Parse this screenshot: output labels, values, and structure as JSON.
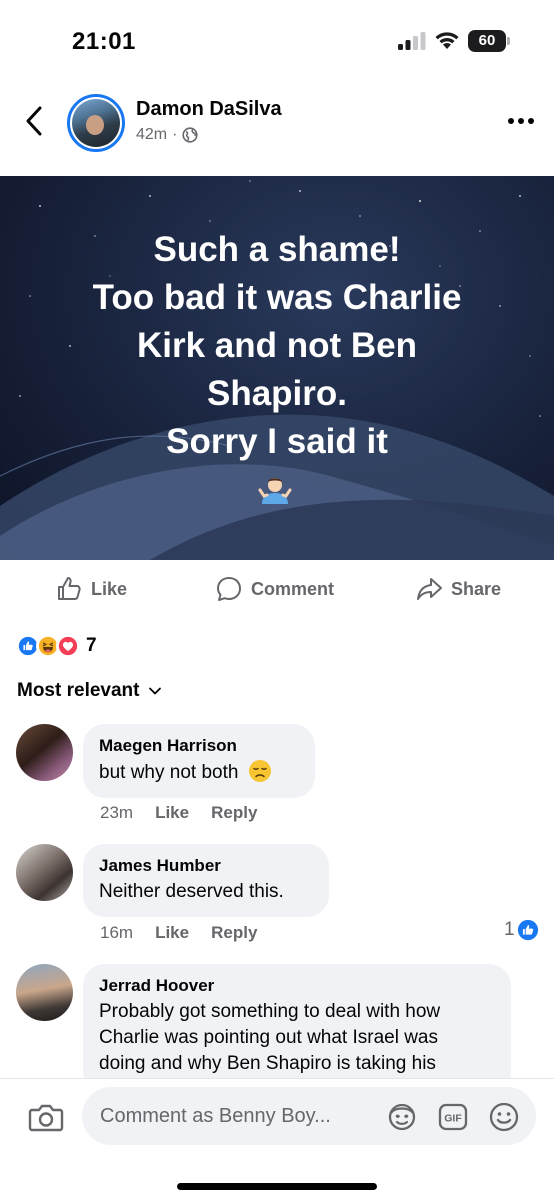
{
  "status_bar": {
    "time": "21:01",
    "battery": "60"
  },
  "post": {
    "author": "Damon DaSilva",
    "time": "42m",
    "separator": "·",
    "privacy_icon": "globe-icon",
    "image_text_lines": [
      "Such a shame!",
      "Too bad it was Charlie",
      "Kirk and not Ben",
      "Shapiro.",
      "Sorry I said it"
    ],
    "image_emoji": "person-shrugging-emoji"
  },
  "actions": {
    "like": "Like",
    "comment": "Comment",
    "share": "Share"
  },
  "reactions": {
    "icons": [
      "like-reaction",
      "haha-reaction",
      "love-reaction"
    ],
    "count": "7"
  },
  "sort": {
    "label": "Most relevant"
  },
  "comments": [
    {
      "name": "Maegen Harrison",
      "text": "but why not both",
      "emoji": "disappointed-face-emoji",
      "time": "23m",
      "like": "Like",
      "reply": "Reply"
    },
    {
      "name": "James Humber",
      "text": "Neither deserved this.",
      "time": "16m",
      "like": "Like",
      "reply": "Reply",
      "likes_count": "1"
    },
    {
      "name": "Jerrad Hoover",
      "text_lines": [
        "Probably got something to deal with how",
        "Charlie was pointing out what Israel was",
        "doing and why Ben Shapiro is taking his"
      ]
    }
  ],
  "composer": {
    "placeholder": "Comment as Benny Boy...",
    "icons": [
      "camera-icon",
      "avatar-sticker-icon",
      "gif-icon",
      "emoji-icon"
    ]
  },
  "colors": {
    "facebook_blue": "#1877f2",
    "secondary_text": "#65676b",
    "bubble_bg": "#f0f2f5",
    "love_red": "#f33e58",
    "haha_yellow": "#f7b125"
  }
}
